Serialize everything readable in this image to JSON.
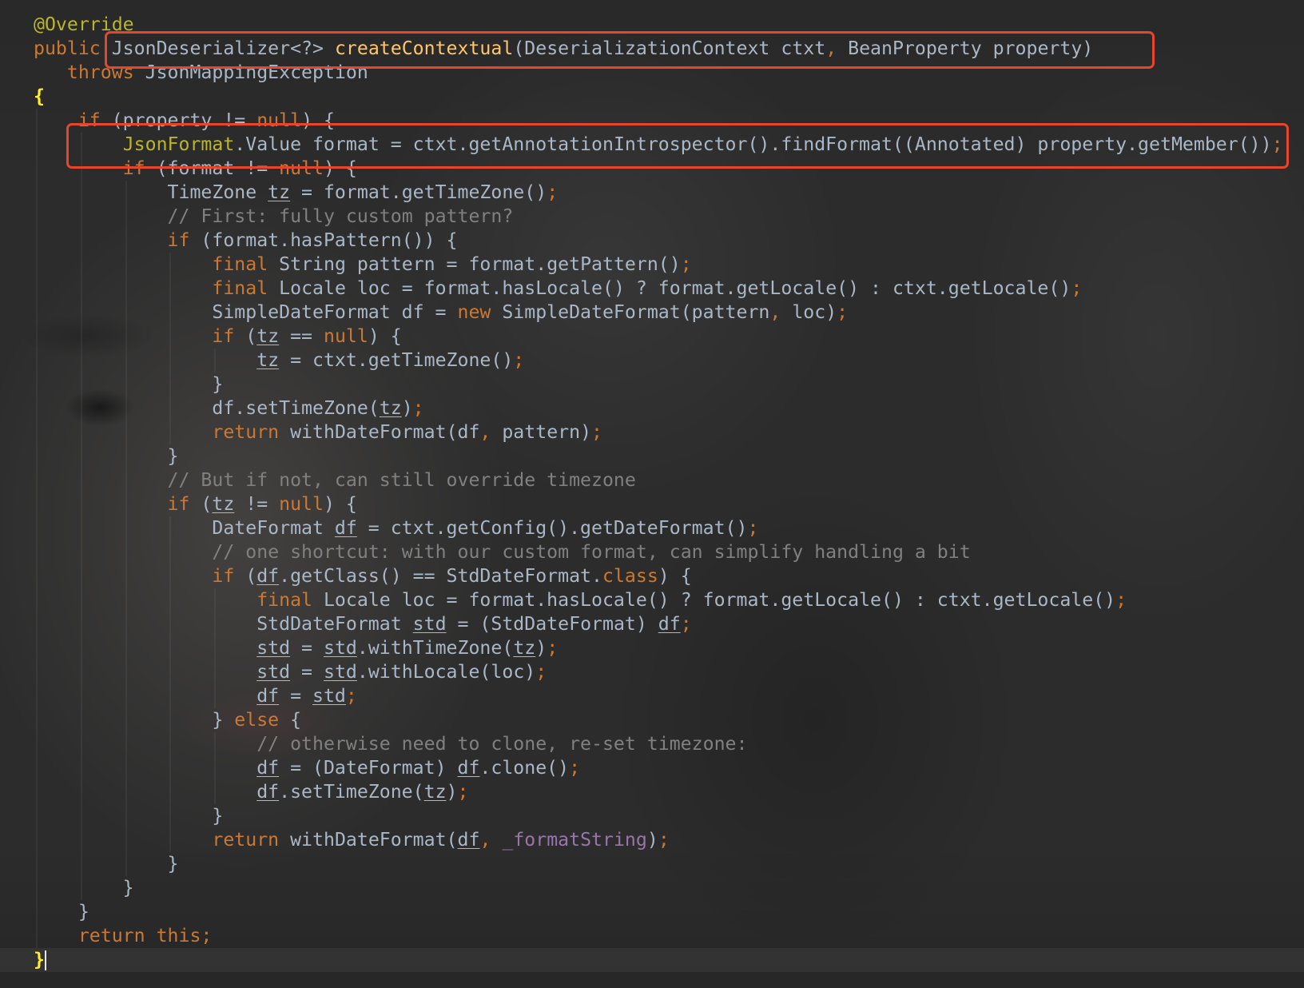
{
  "editor": {
    "theme": {
      "annotation": "#BBB529",
      "keyword": "#CC7832",
      "plain": "#A9B7C6",
      "method": "#FFC66D",
      "comment": "#808080",
      "punct": "#CC7832",
      "field": "#9876AA",
      "var": "#A9B7C6",
      "brace": "#FFEF28"
    },
    "lines": [
      [
        {
          "annotation": "@Override"
        }
      ],
      [
        {
          "keyword": "public"
        },
        {
          "plain": " JsonDeserializer<?> "
        },
        {
          "method": "createContextual"
        },
        {
          "plain": "(DeserializationContext ctxt"
        },
        {
          "punct": ","
        },
        {
          "plain": " BeanProperty property)"
        }
      ],
      [
        {
          "plain": "   "
        },
        {
          "keyword": "throws"
        },
        {
          "plain": " JsonMappingException"
        }
      ],
      [
        {
          "brace": "{"
        }
      ],
      [
        {
          "plain": "    "
        },
        {
          "keyword": "if"
        },
        {
          "plain": " (property != "
        },
        {
          "keyword": "null"
        },
        {
          "plain": ") {"
        }
      ],
      [
        {
          "plain": "        "
        },
        {
          "annotation": "JsonFormat"
        },
        {
          "plain": ".Value format = ctxt.getAnnotationIntrospector().findFormat((Annotated) property.getMember())"
        },
        {
          "punct": ";"
        }
      ],
      [
        {
          "plain": "        "
        },
        {
          "keyword": "if"
        },
        {
          "plain": " (format != "
        },
        {
          "keyword": "null"
        },
        {
          "plain": ") {"
        }
      ],
      [
        {
          "plain": "            TimeZone "
        },
        {
          "var": "tz"
        },
        {
          "plain": " = format.getTimeZone()"
        },
        {
          "punct": ";"
        }
      ],
      [
        {
          "plain": "            "
        },
        {
          "comment": "// First: fully custom pattern?"
        }
      ],
      [
        {
          "plain": "            "
        },
        {
          "keyword": "if"
        },
        {
          "plain": " (format.hasPattern()) {"
        }
      ],
      [
        {
          "plain": "                "
        },
        {
          "keyword": "final"
        },
        {
          "plain": " String pattern = format.getPattern()"
        },
        {
          "punct": ";"
        }
      ],
      [
        {
          "plain": "                "
        },
        {
          "keyword": "final"
        },
        {
          "plain": " Locale loc = format.hasLocale() ? format.getLocale() : ctxt.getLocale()"
        },
        {
          "punct": ";"
        }
      ],
      [
        {
          "plain": "                SimpleDateFormat df = "
        },
        {
          "keyword": "new"
        },
        {
          "plain": " SimpleDateFormat(pattern"
        },
        {
          "punct": ","
        },
        {
          "plain": " loc)"
        },
        {
          "punct": ";"
        }
      ],
      [
        {
          "plain": "                "
        },
        {
          "keyword": "if"
        },
        {
          "plain": " ("
        },
        {
          "var": "tz"
        },
        {
          "plain": " == "
        },
        {
          "keyword": "null"
        },
        {
          "plain": ") {"
        }
      ],
      [
        {
          "plain": "                    "
        },
        {
          "var": "tz"
        },
        {
          "plain": " = ctxt.getTimeZone()"
        },
        {
          "punct": ";"
        }
      ],
      [
        {
          "plain": "                }"
        }
      ],
      [
        {
          "plain": "                df.setTimeZone("
        },
        {
          "var": "tz"
        },
        {
          "plain": ")"
        },
        {
          "punct": ";"
        }
      ],
      [
        {
          "plain": "                "
        },
        {
          "keyword": "return"
        },
        {
          "plain": " withDateFormat(df"
        },
        {
          "punct": ","
        },
        {
          "plain": " pattern)"
        },
        {
          "punct": ";"
        }
      ],
      [
        {
          "plain": "            }"
        }
      ],
      [
        {
          "plain": "            "
        },
        {
          "comment": "// But if not, can still override timezone"
        }
      ],
      [
        {
          "plain": "            "
        },
        {
          "keyword": "if"
        },
        {
          "plain": " ("
        },
        {
          "var": "tz"
        },
        {
          "plain": " != "
        },
        {
          "keyword": "null"
        },
        {
          "plain": ") {"
        }
      ],
      [
        {
          "plain": "                DateFormat "
        },
        {
          "var": "df"
        },
        {
          "plain": " = ctxt.getConfig().getDateFormat()"
        },
        {
          "punct": ";"
        }
      ],
      [
        {
          "plain": "                "
        },
        {
          "comment": "// one shortcut: with our custom format, can simplify handling a bit"
        }
      ],
      [
        {
          "plain": "                "
        },
        {
          "keyword": "if"
        },
        {
          "plain": " ("
        },
        {
          "var": "df"
        },
        {
          "plain": ".getClass() == StdDateFormat."
        },
        {
          "keyword": "class"
        },
        {
          "plain": ") {"
        }
      ],
      [
        {
          "plain": "                    "
        },
        {
          "keyword": "final"
        },
        {
          "plain": " Locale loc = format.hasLocale() ? format.getLocale() : ctxt.getLocale()"
        },
        {
          "punct": ";"
        }
      ],
      [
        {
          "plain": "                    StdDateFormat "
        },
        {
          "var": "std"
        },
        {
          "plain": " = (StdDateFormat) "
        },
        {
          "var": "df"
        },
        {
          "punct": ";"
        }
      ],
      [
        {
          "plain": "                    "
        },
        {
          "var": "std"
        },
        {
          "plain": " = "
        },
        {
          "var": "std"
        },
        {
          "plain": ".withTimeZone("
        },
        {
          "var": "tz"
        },
        {
          "plain": ")"
        },
        {
          "punct": ";"
        }
      ],
      [
        {
          "plain": "                    "
        },
        {
          "var": "std"
        },
        {
          "plain": " = "
        },
        {
          "var": "std"
        },
        {
          "plain": ".withLocale(loc)"
        },
        {
          "punct": ";"
        }
      ],
      [
        {
          "plain": "                    "
        },
        {
          "var": "df"
        },
        {
          "plain": " = "
        },
        {
          "var": "std"
        },
        {
          "punct": ";"
        }
      ],
      [
        {
          "plain": "                } "
        },
        {
          "keyword": "else"
        },
        {
          "plain": " {"
        }
      ],
      [
        {
          "plain": "                    "
        },
        {
          "comment": "// otherwise need to clone, re-set timezone:"
        }
      ],
      [
        {
          "plain": "                    "
        },
        {
          "var": "df"
        },
        {
          "plain": " = (DateFormat) "
        },
        {
          "var": "df"
        },
        {
          "plain": ".clone()"
        },
        {
          "punct": ";"
        }
      ],
      [
        {
          "plain": "                    "
        },
        {
          "var": "df"
        },
        {
          "plain": ".setTimeZone("
        },
        {
          "var": "tz"
        },
        {
          "plain": ")"
        },
        {
          "punct": ";"
        }
      ],
      [
        {
          "plain": "                }"
        }
      ],
      [
        {
          "plain": "                "
        },
        {
          "keyword": "return"
        },
        {
          "plain": " withDateFormat("
        },
        {
          "var": "df"
        },
        {
          "punct": ","
        },
        {
          "plain": " "
        },
        {
          "field": "_formatString"
        },
        {
          "plain": ")"
        },
        {
          "punct": ";"
        }
      ],
      [
        {
          "plain": "            }"
        }
      ],
      [
        {
          "plain": "        }"
        }
      ],
      [
        {
          "plain": "    }"
        }
      ],
      [
        {
          "plain": "    "
        },
        {
          "keyword": "return"
        },
        {
          "plain": " "
        },
        {
          "keyword": "this"
        },
        {
          "punct": ";"
        }
      ],
      [
        {
          "brace": "}"
        }
      ]
    ]
  },
  "annotations": {
    "box_color": "#E8462B"
  }
}
